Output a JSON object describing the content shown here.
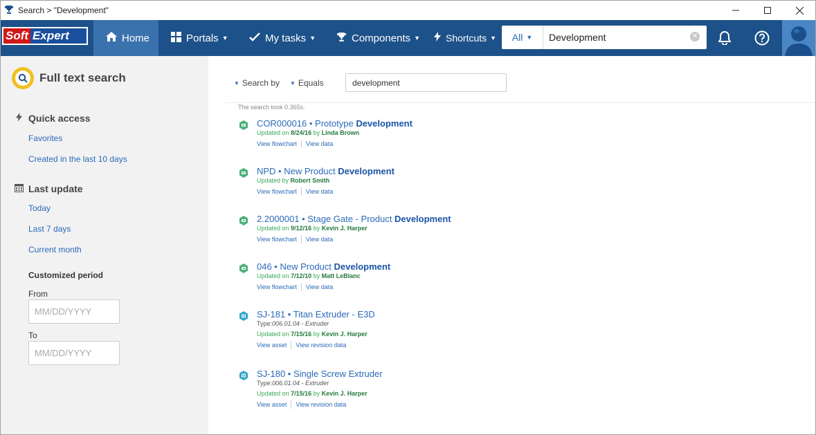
{
  "window": {
    "title": "Search > \"Development\"",
    "controls": {
      "minimize": "—",
      "maximize": "☐",
      "close": "✕"
    }
  },
  "navbar": {
    "logo": {
      "part1": "Soft",
      "part2": "Expert"
    },
    "items": [
      {
        "label": "Home",
        "icon": "home-icon",
        "active": true
      },
      {
        "label": "Portals",
        "icon": "grid-icon",
        "dropdown": true
      },
      {
        "label": "My tasks",
        "icon": "check-icon",
        "dropdown": true
      },
      {
        "label": "Components",
        "icon": "trophy-icon",
        "dropdown": true
      },
      {
        "label": "Shortcuts",
        "icon": "bolt-icon",
        "dropdown": true
      }
    ],
    "search": {
      "scope": "All",
      "value": "Development"
    },
    "colors": {
      "bar": "#1d5189",
      "active": "#3a72ad"
    }
  },
  "sidebar": {
    "header": "Full text search",
    "quick_access": {
      "title": "Quick access",
      "links": [
        "Favorites",
        "Created in the last 10 days"
      ]
    },
    "last_update": {
      "title": "Last update",
      "links": [
        "Today",
        "Last 7 days",
        "Current month"
      ]
    },
    "custom_period": {
      "title": "Customized period",
      "from_label": "From",
      "to_label": "To",
      "from_placeholder": "MM/DD/YYYY",
      "to_placeholder": "MM/DD/YYYY"
    }
  },
  "main": {
    "filters": {
      "search_by": "Search by",
      "equals": "Equals",
      "query": "development"
    },
    "took": "The search took 0.365s.",
    "results": [
      {
        "icon": "process-icon",
        "title_prefix": "COR000016 • Prototype ",
        "title_highlight": "Development",
        "updated_label": "Updated on",
        "date": "8/24/16",
        "by": "by",
        "user": "Linda Brown",
        "actions": [
          "View flowchart",
          "View data"
        ]
      },
      {
        "icon": "process-icon",
        "title_prefix": "NPD • New Product ",
        "title_highlight": "Development",
        "updated_label": "Updated by",
        "date": "",
        "by": "",
        "user": "Robert Smith",
        "actions": [
          "View flowchart",
          "View data"
        ]
      },
      {
        "icon": "process-icon",
        "title_prefix": "2.2000001 • Stage Gate - Product ",
        "title_highlight": "Development",
        "updated_label": "Updated on",
        "date": "9/12/16",
        "by": "by",
        "user": "Kevin J. Harper",
        "actions": [
          "View flowchart",
          "View data"
        ]
      },
      {
        "icon": "process-icon",
        "title_prefix": "046 • New Product ",
        "title_highlight": "Development",
        "updated_label": "Updated on",
        "date": "7/12/10",
        "by": "by",
        "user": "Matt LeBlanc",
        "actions": [
          "View flowchart",
          "View data"
        ]
      },
      {
        "icon": "asset-icon",
        "title_prefix": "SJ-181 • Titan Extruder - E3D",
        "title_highlight": "",
        "type_label": "Type:",
        "type_value": "006.01.04 - Extruder",
        "updated_label": "Updated on",
        "date": "7/15/16",
        "by": "by",
        "user": "Kevin J. Harper",
        "actions": [
          "View asset",
          "View revision data"
        ]
      },
      {
        "icon": "asset-icon",
        "title_prefix": "SJ-180 • Single Screw Extruder",
        "title_highlight": "",
        "type_label": "Type:",
        "type_value": "006.01.04 - Extruder",
        "updated_label": "Updated on",
        "date": "7/15/16",
        "by": "by",
        "user": "Kevin J. Harper",
        "actions": [
          "View asset",
          "View revision data"
        ]
      }
    ]
  }
}
